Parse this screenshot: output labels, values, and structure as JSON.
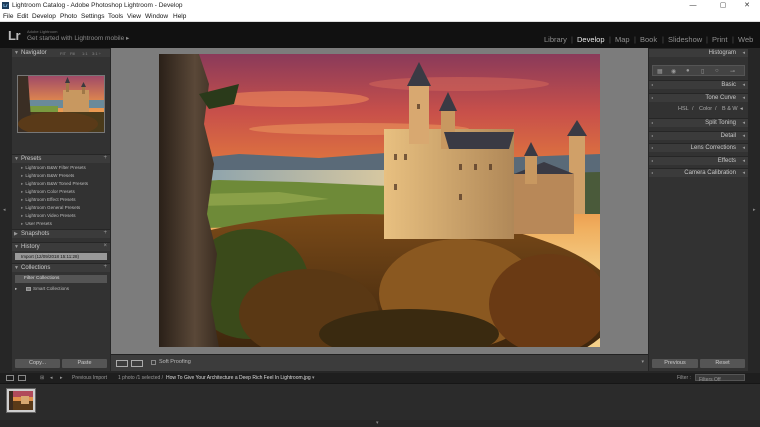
{
  "window": {
    "title": "Lightroom Catalog - Adobe Photoshop Lightroom - Develop",
    "app_icon": "Lr",
    "minimize": "—",
    "maximize": "▢",
    "close": "✕"
  },
  "menu": [
    "File",
    "Edit",
    "Develop",
    "Photo",
    "Settings",
    "Tools",
    "View",
    "Window",
    "Help"
  ],
  "identity": {
    "logo": "Lr",
    "account": "Adobe Lightroom",
    "mobile_prompt": "Get started with Lightroom mobile ▸"
  },
  "modules": {
    "items": [
      "Library",
      "Develop",
      "Map",
      "Book",
      "Slideshow",
      "Print",
      "Web"
    ],
    "active": "Develop"
  },
  "left_panel": {
    "navigator": {
      "title": "Navigator",
      "zoom_fit": "FIT",
      "zoom_fill": "Fill",
      "zoom_1": "1:1",
      "zoom_custom": "3:1 ÷"
    },
    "presets": {
      "title": "Presets",
      "items": [
        "Lightroom B&W Filter Presets",
        "Lightroom B&W Presets",
        "Lightroom B&W Toned Presets",
        "Lightroom Color Presets",
        "Lightroom Effect Presets",
        "Lightroom General Presets",
        "Lightroom Video Presets",
        "User Presets"
      ]
    },
    "snapshots": {
      "title": "Snapshots"
    },
    "history": {
      "title": "History",
      "items": [
        "Import (12/09/2018 15:11:28)"
      ]
    },
    "collections": {
      "title": "Collections",
      "filter_label": "Filter Collections",
      "items": [
        "Smart Collections"
      ]
    },
    "copy_button": "Copy...",
    "paste_button": "Paste"
  },
  "right_panel": {
    "panels": [
      "Histogram",
      "Basic",
      "Tone Curve",
      "Split Toning",
      "Detail",
      "Lens Corrections",
      "Effects",
      "Camera Calibration"
    ],
    "hsl_tabs": [
      "HSL",
      "/",
      "Color",
      "/",
      "B & W"
    ],
    "previous_button": "Previous",
    "reset_button": "Reset"
  },
  "toolbar": {
    "soft_proofing": "Soft Proofing"
  },
  "filmstrip_bar": {
    "source": "Previous Import",
    "count": "1 photo /1 selected /",
    "filename": "How To Give Your Architecture a Deep Rich Feel In Lightroom.jpg",
    "filename_arrow": "▾",
    "filter_label": "Filter :",
    "filter_value": "Filters Off"
  },
  "colors": {
    "background": "#262626",
    "panel": "#323232",
    "panel_header": "#3b3b3b",
    "module_active": "#e8e8e8",
    "module_inactive": "#8f8f8f",
    "view_bg": "#7c7c7c"
  }
}
